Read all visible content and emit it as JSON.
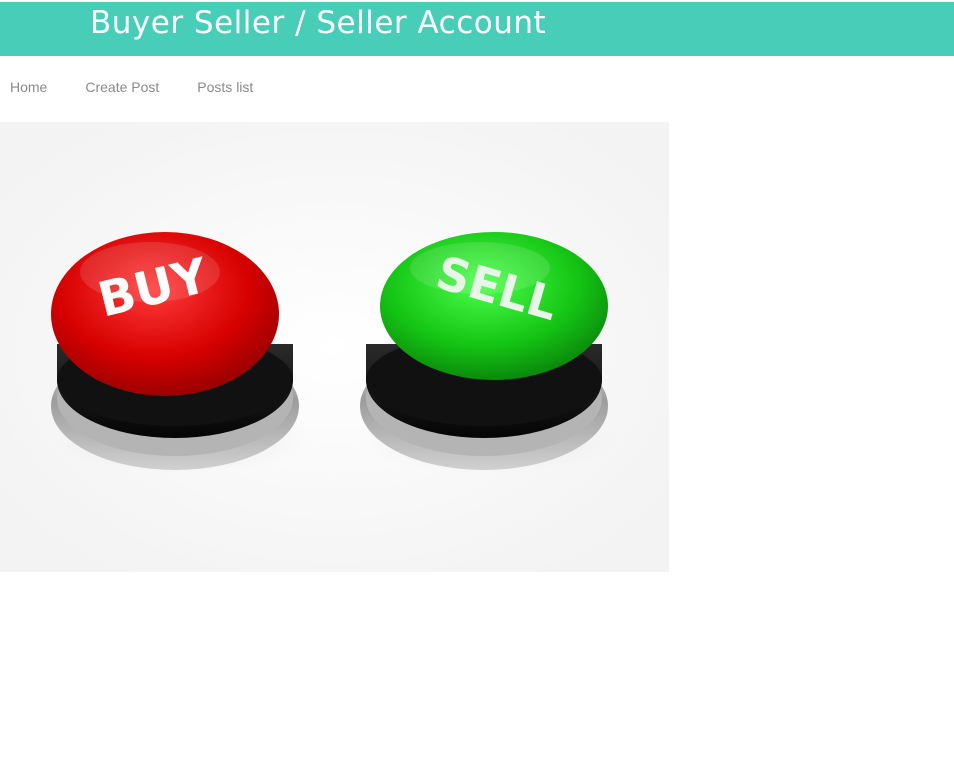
{
  "header": {
    "title": "Buyer Seller / Seller Account",
    "background_color": "#48cdb9"
  },
  "nav": {
    "items": [
      {
        "label": "Home"
      },
      {
        "label": "Create Post"
      },
      {
        "label": "Posts list"
      }
    ]
  },
  "hero": {
    "buttons": [
      {
        "label": "BUY",
        "color": "#d40000"
      },
      {
        "label": "SELL",
        "color": "#15c21a"
      }
    ]
  }
}
